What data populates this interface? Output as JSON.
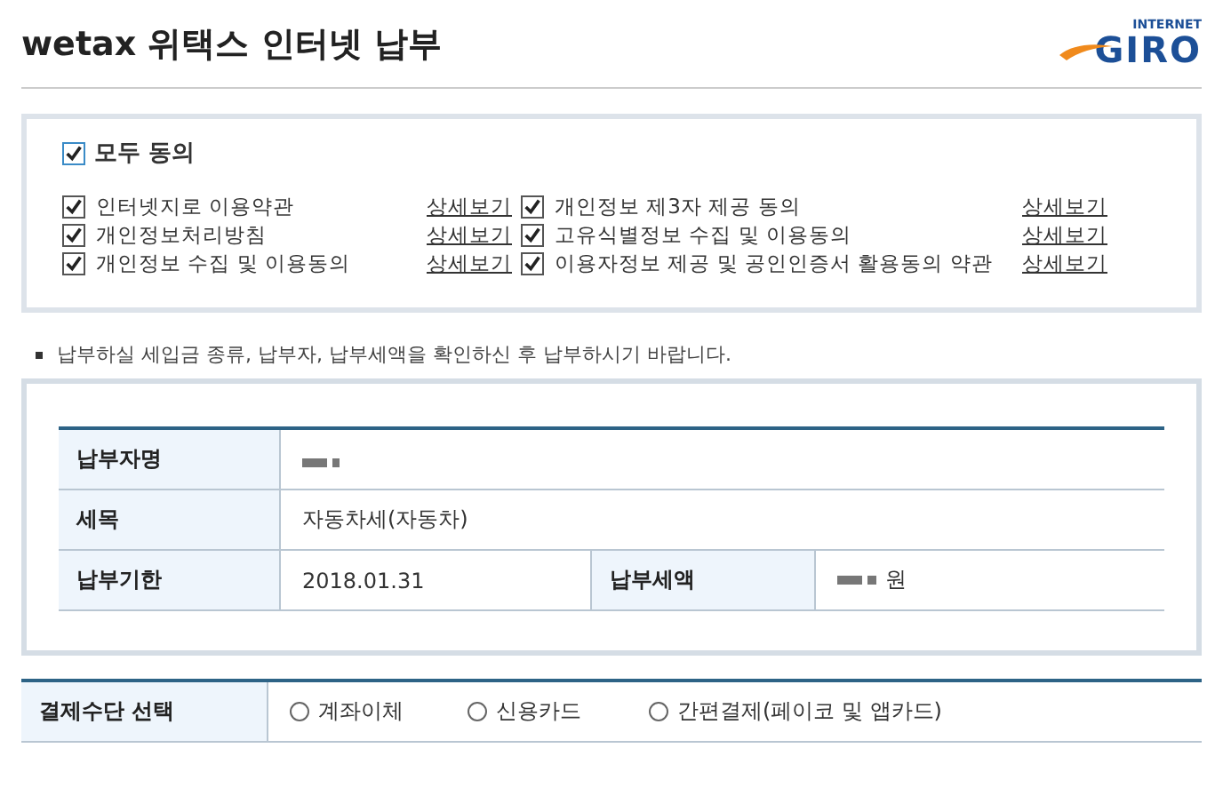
{
  "header": {
    "title": "wetax 위택스 인터넷 납부",
    "logo": {
      "top": "INTERNET",
      "main": "GIRO"
    }
  },
  "agreement": {
    "all": {
      "label": "모두 동의",
      "checked": true
    },
    "items": [
      {
        "label": "인터넷지로 이용약관",
        "checked": true,
        "link": "상세보기"
      },
      {
        "label": "개인정보 제3자 제공 동의",
        "checked": true,
        "link": "상세보기"
      },
      {
        "label": "개인정보처리방침",
        "checked": true,
        "link": "상세보기"
      },
      {
        "label": "고유식별정보 수집 및 이용동의",
        "checked": true,
        "link": "상세보기"
      },
      {
        "label": "개인정보 수집 및 이용동의",
        "checked": true,
        "link": "상세보기"
      },
      {
        "label": "이용자정보 제공 및 공인인증서 활용동의 약관",
        "checked": true,
        "link": "상세보기"
      }
    ]
  },
  "notice": "납부하실 세입금 종류, 납부자, 납부세액을 확인하신 후 납부하시기 바랍니다.",
  "details": {
    "payer_label": "납부자명",
    "tax_label": "세목",
    "tax_value": "자동차세(자동차)",
    "due_label": "납부기한",
    "due_value": "2018.01.31",
    "amount_label": "납부세액",
    "amount_unit": "원"
  },
  "payment": {
    "label": "결제수단 선택",
    "options": [
      {
        "label": "계좌이체",
        "selected": false
      },
      {
        "label": "신용카드",
        "selected": false
      },
      {
        "label": "간편결제(페이코 및 앱카드)",
        "selected": false
      }
    ]
  }
}
